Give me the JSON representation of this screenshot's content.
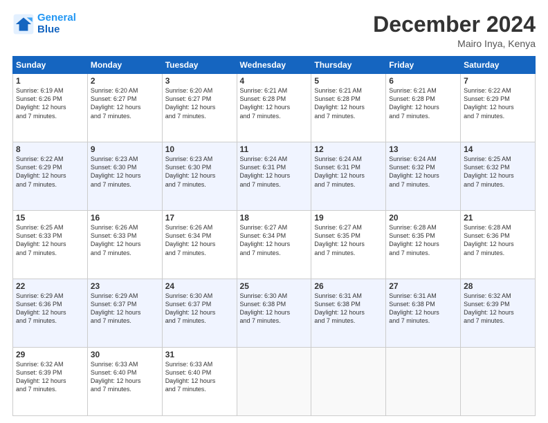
{
  "logo": {
    "line1": "General",
    "line2": "Blue"
  },
  "title": "December 2024",
  "subtitle": "Mairo Inya, Kenya",
  "days_of_week": [
    "Sunday",
    "Monday",
    "Tuesday",
    "Wednesday",
    "Thursday",
    "Friday",
    "Saturday"
  ],
  "weeks": [
    [
      {
        "num": "1",
        "sunrise": "6:19 AM",
        "sunset": "6:26 PM",
        "daylight": "12 hours and 7 minutes."
      },
      {
        "num": "2",
        "sunrise": "6:20 AM",
        "sunset": "6:27 PM",
        "daylight": "12 hours and 7 minutes."
      },
      {
        "num": "3",
        "sunrise": "6:20 AM",
        "sunset": "6:27 PM",
        "daylight": "12 hours and 7 minutes."
      },
      {
        "num": "4",
        "sunrise": "6:21 AM",
        "sunset": "6:28 PM",
        "daylight": "12 hours and 7 minutes."
      },
      {
        "num": "5",
        "sunrise": "6:21 AM",
        "sunset": "6:28 PM",
        "daylight": "12 hours and 7 minutes."
      },
      {
        "num": "6",
        "sunrise": "6:21 AM",
        "sunset": "6:28 PM",
        "daylight": "12 hours and 7 minutes."
      },
      {
        "num": "7",
        "sunrise": "6:22 AM",
        "sunset": "6:29 PM",
        "daylight": "12 hours and 7 minutes."
      }
    ],
    [
      {
        "num": "8",
        "sunrise": "6:22 AM",
        "sunset": "6:29 PM",
        "daylight": "12 hours and 7 minutes."
      },
      {
        "num": "9",
        "sunrise": "6:23 AM",
        "sunset": "6:30 PM",
        "daylight": "12 hours and 7 minutes."
      },
      {
        "num": "10",
        "sunrise": "6:23 AM",
        "sunset": "6:30 PM",
        "daylight": "12 hours and 7 minutes."
      },
      {
        "num": "11",
        "sunrise": "6:24 AM",
        "sunset": "6:31 PM",
        "daylight": "12 hours and 7 minutes."
      },
      {
        "num": "12",
        "sunrise": "6:24 AM",
        "sunset": "6:31 PM",
        "daylight": "12 hours and 7 minutes."
      },
      {
        "num": "13",
        "sunrise": "6:24 AM",
        "sunset": "6:32 PM",
        "daylight": "12 hours and 7 minutes."
      },
      {
        "num": "14",
        "sunrise": "6:25 AM",
        "sunset": "6:32 PM",
        "daylight": "12 hours and 7 minutes."
      }
    ],
    [
      {
        "num": "15",
        "sunrise": "6:25 AM",
        "sunset": "6:33 PM",
        "daylight": "12 hours and 7 minutes."
      },
      {
        "num": "16",
        "sunrise": "6:26 AM",
        "sunset": "6:33 PM",
        "daylight": "12 hours and 7 minutes."
      },
      {
        "num": "17",
        "sunrise": "6:26 AM",
        "sunset": "6:34 PM",
        "daylight": "12 hours and 7 minutes."
      },
      {
        "num": "18",
        "sunrise": "6:27 AM",
        "sunset": "6:34 PM",
        "daylight": "12 hours and 7 minutes."
      },
      {
        "num": "19",
        "sunrise": "6:27 AM",
        "sunset": "6:35 PM",
        "daylight": "12 hours and 7 minutes."
      },
      {
        "num": "20",
        "sunrise": "6:28 AM",
        "sunset": "6:35 PM",
        "daylight": "12 hours and 7 minutes."
      },
      {
        "num": "21",
        "sunrise": "6:28 AM",
        "sunset": "6:36 PM",
        "daylight": "12 hours and 7 minutes."
      }
    ],
    [
      {
        "num": "22",
        "sunrise": "6:29 AM",
        "sunset": "6:36 PM",
        "daylight": "12 hours and 7 minutes."
      },
      {
        "num": "23",
        "sunrise": "6:29 AM",
        "sunset": "6:37 PM",
        "daylight": "12 hours and 7 minutes."
      },
      {
        "num": "24",
        "sunrise": "6:30 AM",
        "sunset": "6:37 PM",
        "daylight": "12 hours and 7 minutes."
      },
      {
        "num": "25",
        "sunrise": "6:30 AM",
        "sunset": "6:38 PM",
        "daylight": "12 hours and 7 minutes."
      },
      {
        "num": "26",
        "sunrise": "6:31 AM",
        "sunset": "6:38 PM",
        "daylight": "12 hours and 7 minutes."
      },
      {
        "num": "27",
        "sunrise": "6:31 AM",
        "sunset": "6:38 PM",
        "daylight": "12 hours and 7 minutes."
      },
      {
        "num": "28",
        "sunrise": "6:32 AM",
        "sunset": "6:39 PM",
        "daylight": "12 hours and 7 minutes."
      }
    ],
    [
      {
        "num": "29",
        "sunrise": "6:32 AM",
        "sunset": "6:39 PM",
        "daylight": "12 hours and 7 minutes."
      },
      {
        "num": "30",
        "sunrise": "6:33 AM",
        "sunset": "6:40 PM",
        "daylight": "12 hours and 7 minutes."
      },
      {
        "num": "31",
        "sunrise": "6:33 AM",
        "sunset": "6:40 PM",
        "daylight": "12 hours and 7 minutes."
      },
      null,
      null,
      null,
      null
    ]
  ]
}
